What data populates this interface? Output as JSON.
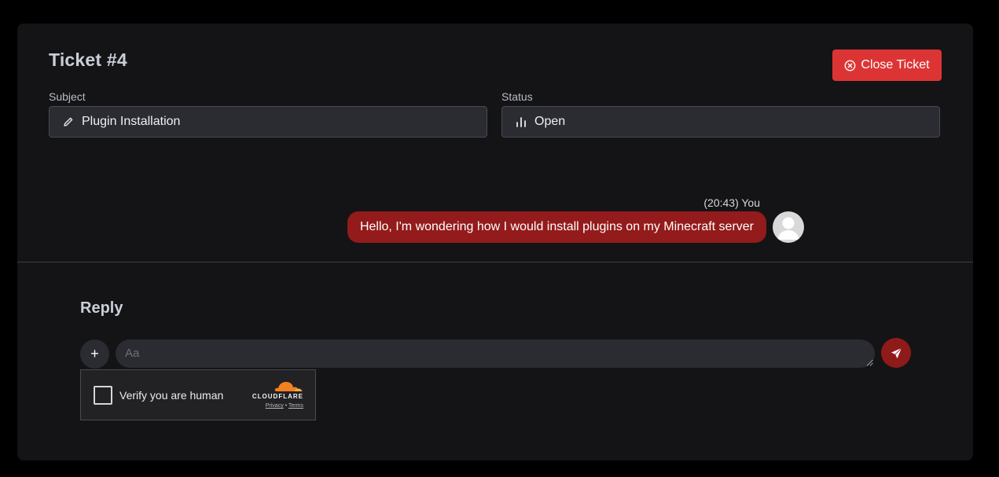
{
  "ticket": {
    "title": "Ticket #4",
    "close_label": "Close Ticket"
  },
  "fields": {
    "subject_label": "Subject",
    "subject_value": "Plugin Installation",
    "status_label": "Status",
    "status_value": "Open"
  },
  "messages": [
    {
      "meta": "(20:43) You",
      "text": "Hello, I'm wondering how I would install plugins on my Minecraft server"
    }
  ],
  "reply": {
    "title": "Reply",
    "add_label": "+",
    "placeholder": "Aa"
  },
  "captcha": {
    "label": "Verify you are human",
    "brand": "CLOUDFLARE",
    "privacy": "Privacy",
    "separator": "•",
    "terms": "Terms"
  },
  "colors": {
    "background": "#000000",
    "card": "#141416",
    "close_button": "#dc3434",
    "message_bubble": "#941b1b",
    "send_button": "#8f1a1a",
    "field_bg": "#2b2c31",
    "cloudflare_orange": "#f48120"
  },
  "icons": {
    "close": "x-circle-icon",
    "subject": "pencil-icon",
    "status": "bar-chart-icon",
    "send": "paper-plane-icon",
    "avatar": "user-avatar-icon",
    "brand": "cloudflare-cloud-icon"
  }
}
